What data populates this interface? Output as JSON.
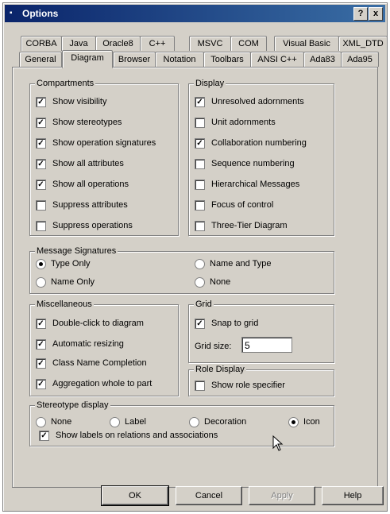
{
  "window": {
    "title": "Options",
    "help_label": "?",
    "close_label": "x"
  },
  "tabs_row1": [
    "CORBA",
    "Java",
    "Oracle8",
    "C++",
    "MSVC",
    "COM",
    "Visual Basic",
    "XML_DTD"
  ],
  "tabs_row2": [
    "General",
    "Diagram",
    "Browser",
    "Notation",
    "Toolbars",
    "ANSI C++",
    "Ada83",
    "Ada95"
  ],
  "active_tab": "Diagram",
  "compartments": {
    "legend": "Compartments",
    "items": [
      {
        "label": "Show visibility",
        "checked": true
      },
      {
        "label": "Show stereotypes",
        "checked": true
      },
      {
        "label": "Show operation signatures",
        "checked": true
      },
      {
        "label": "Show all attributes",
        "checked": true
      },
      {
        "label": "Show all operations",
        "checked": true
      },
      {
        "label": "Suppress attributes",
        "checked": false
      },
      {
        "label": "Suppress operations",
        "checked": false
      }
    ]
  },
  "display": {
    "legend": "Display",
    "items": [
      {
        "label": "Unresolved adornments",
        "checked": true
      },
      {
        "label": "Unit adornments",
        "checked": false
      },
      {
        "label": "Collaboration numbering",
        "checked": true
      },
      {
        "label": "Sequence numbering",
        "checked": false
      },
      {
        "label": "Hierarchical Messages",
        "checked": false
      },
      {
        "label": "Focus of control",
        "checked": false
      },
      {
        "label": "Three-Tier Diagram",
        "checked": false
      }
    ]
  },
  "message_signatures": {
    "legend": "Message Signatures",
    "options": [
      {
        "label": "Type Only",
        "selected": true
      },
      {
        "label": "Name and Type",
        "selected": false
      },
      {
        "label": "Name Only",
        "selected": false
      },
      {
        "label": "None",
        "selected": false
      }
    ]
  },
  "miscellaneous": {
    "legend": "Miscellaneous",
    "items": [
      {
        "label": "Double-click to diagram",
        "checked": true
      },
      {
        "label": "Automatic resizing",
        "checked": true
      },
      {
        "label": "Class Name Completion",
        "checked": true
      },
      {
        "label": "Aggregation whole to part",
        "checked": true
      }
    ]
  },
  "grid": {
    "legend": "Grid",
    "snap_label": "Snap to grid",
    "snap_checked": true,
    "size_label": "Grid size:",
    "size_value": "5"
  },
  "role_display": {
    "legend": "Role Display",
    "show_label": "Show role specifier",
    "show_checked": false
  },
  "stereotype_display": {
    "legend": "Stereotype display",
    "options": [
      {
        "label": "None",
        "selected": false
      },
      {
        "label": "Label",
        "selected": false
      },
      {
        "label": "Decoration",
        "selected": false
      },
      {
        "label": "Icon",
        "selected": true
      }
    ],
    "relations_label": "Show labels on relations and associations",
    "relations_checked": true
  },
  "buttons": {
    "ok": "OK",
    "cancel": "Cancel",
    "apply": "Apply",
    "help": "Help"
  }
}
